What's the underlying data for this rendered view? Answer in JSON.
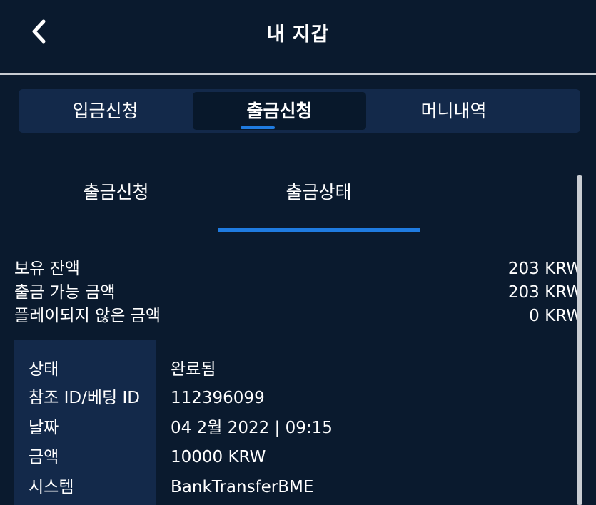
{
  "header": {
    "title": "내 지갑",
    "back_icon": "chevron-left-icon"
  },
  "main_tabs": [
    {
      "label": "입금신청",
      "selected": false
    },
    {
      "label": "출금신청",
      "selected": true
    },
    {
      "label": "머니내역",
      "selected": false
    }
  ],
  "sub_tabs": [
    {
      "label": "출금신청",
      "selected": false
    },
    {
      "label": "출금상태",
      "selected": true
    }
  ],
  "balances": [
    {
      "label": "보유 잔액",
      "value": "203 KRW"
    },
    {
      "label": "출금 가능 금액",
      "value": "203 KRW"
    },
    {
      "label": "플레이되지 않은 금액",
      "value": "0 KRW"
    }
  ],
  "details": [
    {
      "label": "상태",
      "value": "완료됨"
    },
    {
      "label": "참조 ID/베팅 ID",
      "value": "112396099"
    },
    {
      "label": "날짜",
      "value": "04 2월 2022 | 09:15"
    },
    {
      "label": "금액",
      "value": "10000 KRW"
    },
    {
      "label": "시스템",
      "value": "BankTransferBME"
    }
  ],
  "colors": {
    "background": "#0a1a2e",
    "panel": "#13294a",
    "accent": "#1f7be0",
    "text": "#ffffff"
  }
}
